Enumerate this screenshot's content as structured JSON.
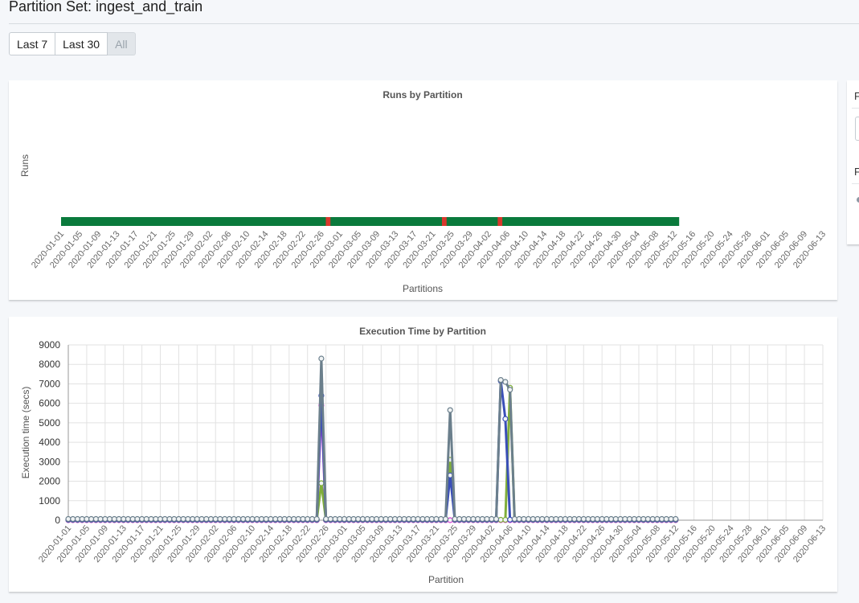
{
  "header": {
    "title": "Partition Set: ingest_and_train"
  },
  "range_buttons": [
    {
      "label": "Last 7",
      "disabled": false
    },
    {
      "label": "Last 30",
      "disabled": false
    },
    {
      "label": "All",
      "disabled": true
    }
  ],
  "side_panel": {
    "label1": "F",
    "label2": "F"
  },
  "colors": {
    "success": "#0a7a3c",
    "failure": "#d8382d",
    "grid": "#e2e2e2",
    "point_outline": "#7a8790"
  },
  "tick_labels": [
    "2020-01-01",
    "2020-01-05",
    "2020-01-09",
    "2020-01-13",
    "2020-01-17",
    "2020-01-21",
    "2020-01-25",
    "2020-01-29",
    "2020-02-02",
    "2020-02-06",
    "2020-02-10",
    "2020-02-14",
    "2020-02-18",
    "2020-02-22",
    "2020-02-26",
    "2020-03-01",
    "2020-03-05",
    "2020-03-09",
    "2020-03-13",
    "2020-03-17",
    "2020-03-21",
    "2020-03-25",
    "2020-03-29",
    "2020-04-02",
    "2020-04-06",
    "2020-04-10",
    "2020-04-14",
    "2020-04-18",
    "2020-04-22",
    "2020-04-26",
    "2020-04-30",
    "2020-05-04",
    "2020-05-08",
    "2020-05-12",
    "2020-05-16",
    "2020-05-20",
    "2020-05-24",
    "2020-05-28",
    "2020-06-01",
    "2020-06-05",
    "2020-06-09",
    "2020-06-13"
  ],
  "chart_data": [
    {
      "type": "heatmap",
      "title": "Runs by Partition",
      "xlabel": "Partitions",
      "ylabel": "Runs",
      "x_start": "2020-01-01",
      "x_end": "2020-06-13",
      "data_start": "2020-01-01",
      "data_end": "2020-05-12",
      "status": "success",
      "failed_partitions": [
        "2020-02-27",
        "2020-03-23",
        "2020-04-04"
      ]
    },
    {
      "type": "line",
      "title": "Execution Time by Partition",
      "xlabel": "Partition",
      "ylabel": "Execution time (secs)",
      "ylim": [
        0,
        9000
      ],
      "yticks": [
        0,
        1000,
        2000,
        3000,
        4000,
        5000,
        6000,
        7000,
        8000,
        9000
      ],
      "x_start": "2020-01-01",
      "x_end": "2020-06-13",
      "grid": true,
      "series": [
        {
          "color": "#6b7f8c",
          "baseline": 60,
          "start": "2020-01-01",
          "end": "2020-05-12",
          "spikes": [
            [
              "2020-02-25",
              8300
            ],
            [
              "2020-03-24",
              5650
            ],
            [
              "2020-04-04",
              7200
            ],
            [
              "2020-04-05",
              7100
            ],
            [
              "2020-04-06",
              6700
            ]
          ]
        },
        {
          "color": "#3a4fb8",
          "baseline": 30,
          "start": "2020-01-01",
          "end": "2020-05-12",
          "spikes": [
            [
              "2020-02-25",
              6400
            ],
            [
              "2020-03-24",
              2300
            ],
            [
              "2020-04-04",
              7150
            ],
            [
              "2020-04-05",
              5200
            ]
          ]
        },
        {
          "color": "#7fae3a",
          "baseline": 20,
          "start": "2020-01-01",
          "end": "2020-05-12",
          "spikes": [
            [
              "2020-02-25",
              1900
            ],
            [
              "2020-03-24",
              3100
            ],
            [
              "2020-04-06",
              6800
            ]
          ]
        },
        {
          "color": "#d63bd6",
          "baseline": 0,
          "start": "2020-01-01",
          "end": "2020-05-12",
          "spikes": [
            [
              "2020-02-25",
              5900
            ]
          ]
        }
      ]
    }
  ]
}
